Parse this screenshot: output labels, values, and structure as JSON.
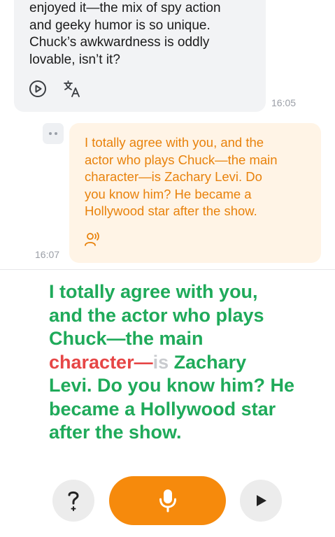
{
  "incoming_message": {
    "text_lines": [
      "enjoyed it—the mix of spy action",
      "and geeky humor is so unique.",
      "Chuck’s awkwardness is oddly",
      "lovable, isn’t it?"
    ],
    "time": "16:05",
    "icons": [
      "play-circle-icon",
      "translate-icon"
    ]
  },
  "outgoing_message": {
    "text_lines": [
      "I totally agree with you, and the",
      "actor who plays Chuck—the main",
      "character—is Zachary Levi. Do",
      "you know him? He became a",
      "Hollywood star after the show."
    ],
    "time": "16:07",
    "icons": [
      "more-dots-icon",
      "speaker-user-icon"
    ]
  },
  "recognition": {
    "line1": "I totally agree with you,",
    "line2": "and the actor who plays",
    "line3": "Chuck—the main",
    "line4_wrong": "character—",
    "line4_missed": "is",
    "line4_rest": " Zachary",
    "line5": "Levi. Do you know him? He",
    "line6": "became a Hollywood star",
    "line7": "after the show."
  },
  "controls": {
    "help_label": "?",
    "icons": [
      "question-icon",
      "microphone-icon",
      "play-icon"
    ],
    "colors": {
      "accent": "#f68a0c",
      "correct": "#1faa5a",
      "wrong": "#e64646",
      "missed": "#c9cbcf"
    }
  }
}
